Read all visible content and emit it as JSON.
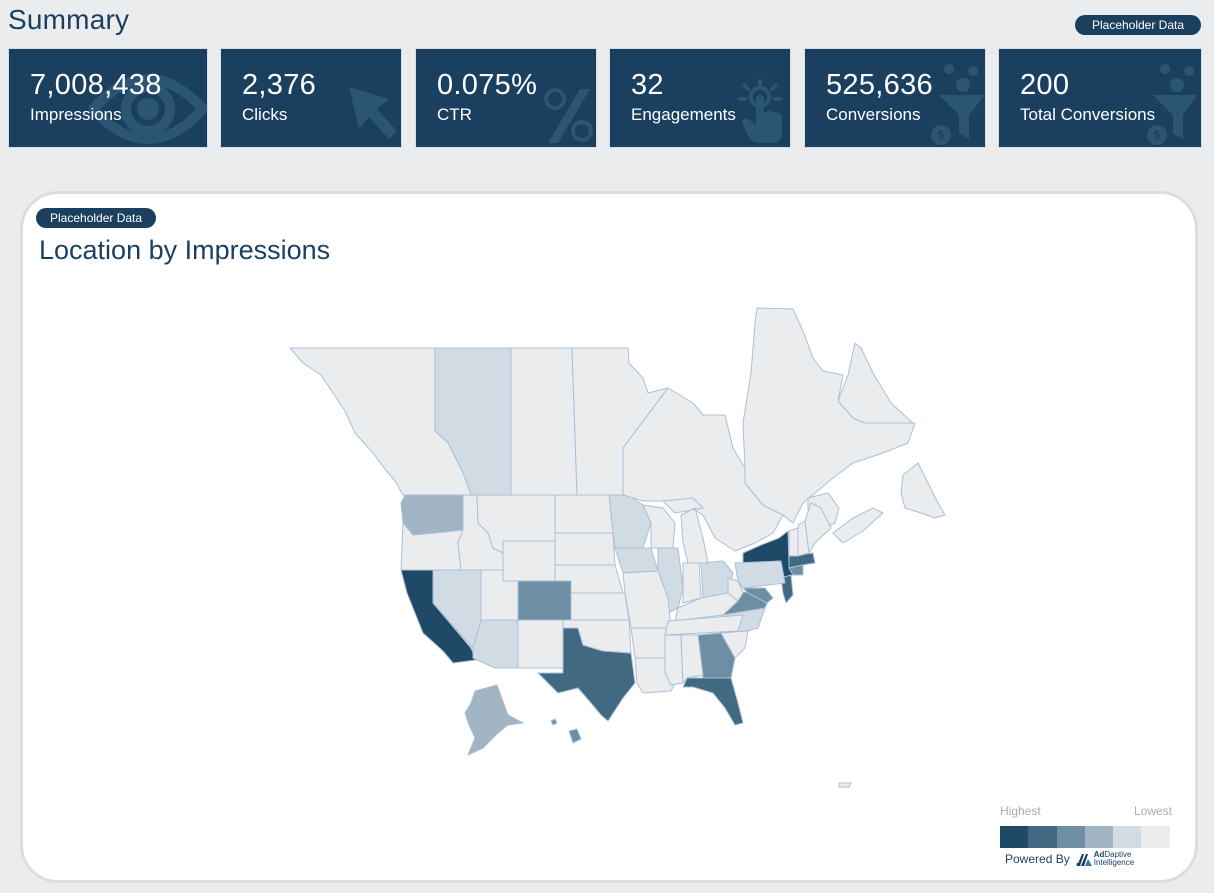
{
  "header": {
    "title": "Summary",
    "badge": "Placeholder Data"
  },
  "kpis": [
    {
      "value": "7,008,438",
      "label": "Impressions",
      "icon": "eye-icon"
    },
    {
      "value": "2,376",
      "label": "Clicks",
      "icon": "cursor-arrow-icon"
    },
    {
      "value": "0.075%",
      "label": "CTR",
      "icon": "percent-icon"
    },
    {
      "value": "32",
      "label": "Engagements",
      "icon": "tap-hand-icon"
    },
    {
      "value": "525,636",
      "label": "Conversions",
      "icon": "funnel-dollar-icon"
    },
    {
      "value": "200",
      "label": "Total Conversions",
      "icon": "funnel-dollar-icon"
    }
  ],
  "colors": {
    "brand": "#1b3f5f",
    "tile_bg": "#1b3f5f",
    "page_bg": "#ebecee",
    "map_border": "#a9c0d8"
  },
  "map_card": {
    "badge": "Placeholder Data",
    "title": "Location by Impressions",
    "powered_by": "Powered By",
    "brand_name_bold": "Ad",
    "brand_name_rest": "Daptive",
    "brand_sub": "Intelligence"
  },
  "chart_data": {
    "type": "heatmap",
    "subtype": "choropleth",
    "title": "Location by Impressions",
    "legend": {
      "high_label": "Highest",
      "low_label": "Lowest",
      "placement": "bottom-right",
      "scale": [
        "#1f4966",
        "#416a82",
        "#6e8ea3",
        "#a1b4c3",
        "#d1dbe4",
        "#ebecee"
      ]
    },
    "regions": [
      {
        "name": "California",
        "level": 1
      },
      {
        "name": "New York",
        "level": 1
      },
      {
        "name": "Texas",
        "level": 2
      },
      {
        "name": "Florida",
        "level": 2
      },
      {
        "name": "New Jersey",
        "level": 2
      },
      {
        "name": "Massachusetts",
        "level": 2
      },
      {
        "name": "Colorado",
        "level": 3
      },
      {
        "name": "Georgia",
        "level": 3
      },
      {
        "name": "Virginia",
        "level": 3
      },
      {
        "name": "Maryland",
        "level": 3
      },
      {
        "name": "Hawaii",
        "level": 3
      },
      {
        "name": "Washington",
        "level": 4
      },
      {
        "name": "Alaska",
        "level": 4
      },
      {
        "name": "Alberta",
        "level": 5
      },
      {
        "name": "Minnesota",
        "level": 5
      },
      {
        "name": "Iowa",
        "level": 5
      },
      {
        "name": "Illinois",
        "level": 5
      },
      {
        "name": "Ohio",
        "level": 5
      },
      {
        "name": "Pennsylvania",
        "level": 5
      },
      {
        "name": "Nevada",
        "level": 5
      },
      {
        "name": "Arizona",
        "level": 5
      },
      {
        "name": "North Carolina",
        "level": 5
      },
      {
        "name": "Connecticut",
        "level": 3
      },
      {
        "name": "British Columbia",
        "level": 6
      },
      {
        "name": "Saskatchewan",
        "level": 6
      },
      {
        "name": "Manitoba",
        "level": 6
      },
      {
        "name": "Ontario",
        "level": 6
      },
      {
        "name": "Quebec",
        "level": 6
      },
      {
        "name": "Newfoundland and Labrador",
        "level": 6
      },
      {
        "name": "New Brunswick",
        "level": 6
      },
      {
        "name": "Nova Scotia",
        "level": 6
      },
      {
        "name": "Oregon",
        "level": 6
      },
      {
        "name": "Idaho",
        "level": 6
      },
      {
        "name": "Montana",
        "level": 6
      },
      {
        "name": "Wyoming",
        "level": 6
      },
      {
        "name": "Utah",
        "level": 6
      },
      {
        "name": "New Mexico",
        "level": 6
      },
      {
        "name": "North Dakota",
        "level": 6
      },
      {
        "name": "South Dakota",
        "level": 6
      },
      {
        "name": "Nebraska",
        "level": 6
      },
      {
        "name": "Kansas",
        "level": 6
      },
      {
        "name": "Oklahoma",
        "level": 6
      },
      {
        "name": "Missouri",
        "level": 6
      },
      {
        "name": "Arkansas",
        "level": 6
      },
      {
        "name": "Louisiana",
        "level": 6
      },
      {
        "name": "Wisconsin",
        "level": 6
      },
      {
        "name": "Michigan",
        "level": 6
      },
      {
        "name": "Indiana",
        "level": 6
      },
      {
        "name": "Kentucky",
        "level": 6
      },
      {
        "name": "Tennessee",
        "level": 6
      },
      {
        "name": "Mississippi",
        "level": 6
      },
      {
        "name": "Alabama",
        "level": 6
      },
      {
        "name": "South Carolina",
        "level": 6
      },
      {
        "name": "West Virginia",
        "level": 6
      },
      {
        "name": "Vermont",
        "level": 6
      },
      {
        "name": "New Hampshire",
        "level": 6
      },
      {
        "name": "Maine",
        "level": 6
      },
      {
        "name": "Puerto Rico",
        "level": 6
      }
    ]
  }
}
